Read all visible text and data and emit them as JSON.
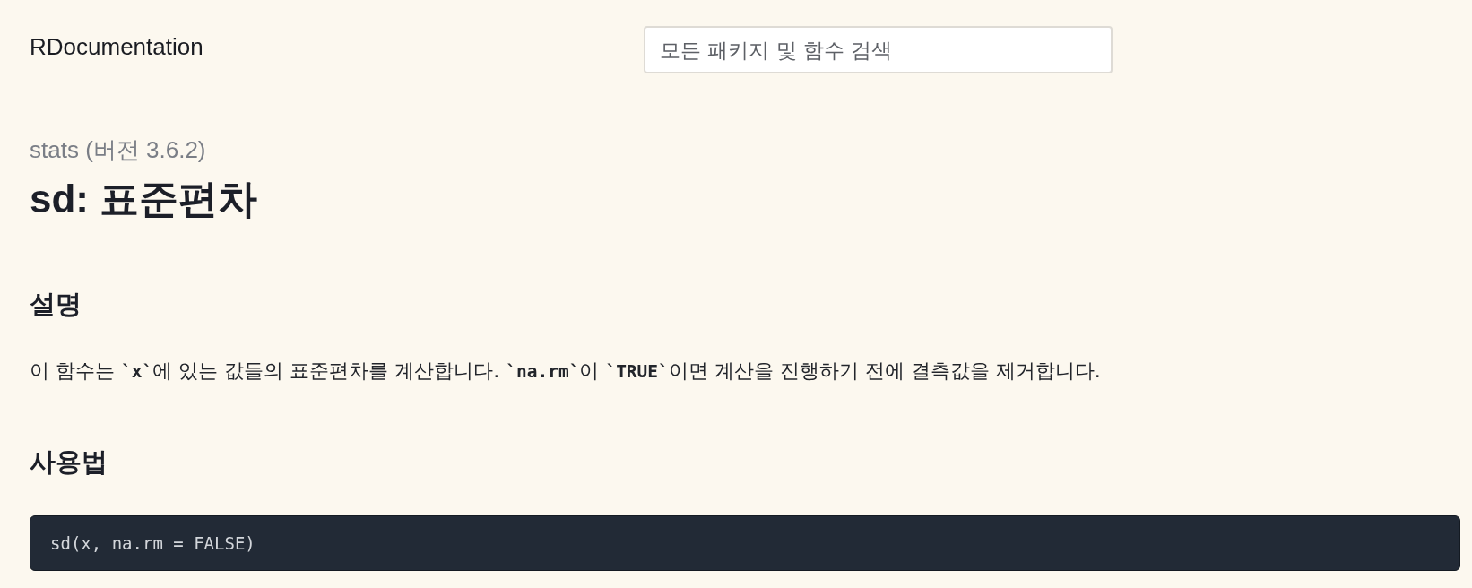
{
  "header": {
    "logo": "RDocumentation",
    "search": {
      "placeholder": "모든 패키지 및 함수 검색"
    }
  },
  "page": {
    "package": "stats (버전 3.6.2)",
    "title": "sd: 표준편차"
  },
  "sections": [
    {
      "kind": "text",
      "heading": "설명",
      "text": "이 함수는 **`x`**에 있는 값들의 표준편차를 계산합니다. **`na.rm`**이 **`TRUE`**이면 계산을 진행하기 전에 결측값을 제거합니다."
    },
    {
      "kind": "code",
      "heading": "사용법",
      "code": "sd(x, na.rm = FALSE)"
    }
  ]
}
